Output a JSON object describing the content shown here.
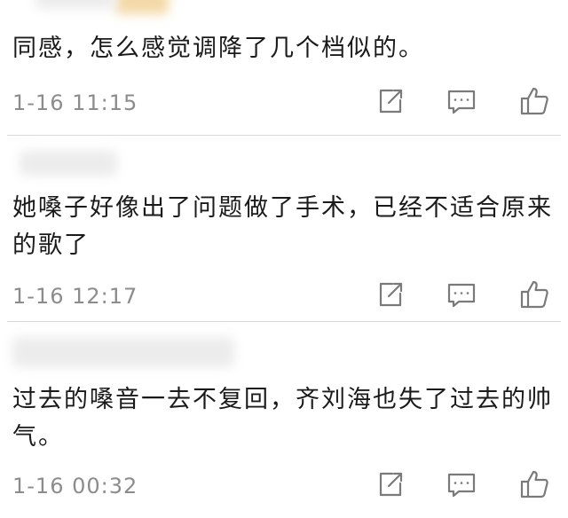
{
  "comments": [
    {
      "text": "同感，怎么感觉调降了几个档似的。",
      "time": "1-16 11:15"
    },
    {
      "text": "她嗓子好像出了问题做了手术，已经不适合原来的歌了",
      "time": "1-16 12:17"
    },
    {
      "text": "过去的嗓音一去不复回，齐刘海也失了过去的帅气。",
      "time": "1-16 00:32"
    }
  ],
  "icons": {
    "share": "share-icon",
    "reply": "reply-icon",
    "like": "like-icon"
  },
  "colors": {
    "icon": "#7a7a7a",
    "timestamp": "#8c8c8c",
    "divider": "#d9d9d9"
  }
}
